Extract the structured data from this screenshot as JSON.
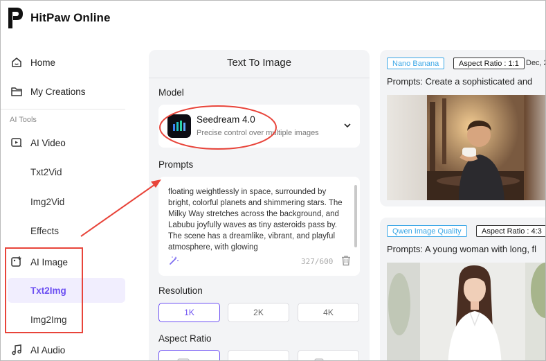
{
  "app": {
    "name": "HitPaw Online"
  },
  "sidebar": {
    "home": "Home",
    "my_creations": "My Creations",
    "section_label": "AI Tools",
    "ai_video": "AI Video",
    "txt2vid": "Txt2Vid",
    "img2vid": "Img2Vid",
    "effects": "Effects",
    "ai_image": "AI Image",
    "txt2img": "Txt2Img",
    "img2img": "Img2Img",
    "ai_audio": "AI Audio",
    "active_item": "Txt2Img"
  },
  "panel": {
    "title": "Text To Image",
    "model_label": "Model",
    "model": {
      "name": "Seedream 4.0",
      "description": "Precise control over multiple images"
    },
    "prompts_label": "Prompts",
    "prompt_text": " floating weightlessly in space, surrounded by bright, colorful planets and shimmering stars. The Milky Way stretches across the background, and Labubu joyfully waves as tiny asteroids pass by. The scene has a dreamlike, vibrant, and playful atmosphere, with glowing",
    "char_count": "327/600",
    "resolution_label": "Resolution",
    "resolutions": [
      "1K",
      "2K",
      "4K"
    ],
    "selected_resolution": "1K",
    "aspect_ratio_label": "Aspect Ratio"
  },
  "gallery": [
    {
      "model_tag": "Nano Banana",
      "aspect_tag": "Aspect Ratio : 1:1",
      "date": "Dec, 2",
      "prompt": "Prompts: Create a sophisticated and"
    },
    {
      "model_tag": "Qwen Image Quality",
      "aspect_tag": "Aspect Ratio : 4:3",
      "date": "",
      "prompt": "Prompts: A young woman with long, fl"
    }
  ],
  "colors": {
    "accent": "#6b4ef2",
    "annotation": "#e8443a",
    "tag_blue": "#39a6e6",
    "panel_bg": "#f3f4f6"
  }
}
